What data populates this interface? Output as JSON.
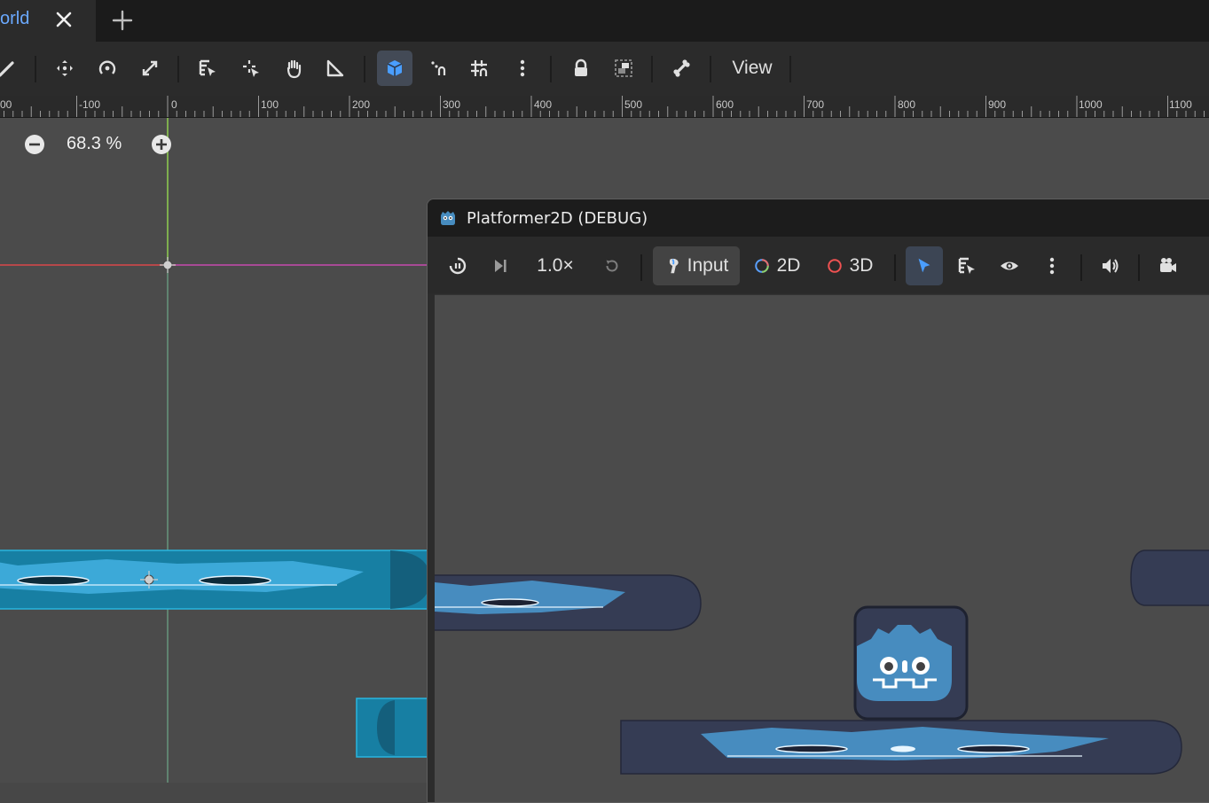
{
  "tabbar": {
    "active_tab_label": "orld",
    "close_icon": "close-icon",
    "add_icon": "plus-icon"
  },
  "toolbar": {
    "view_label": "View",
    "accent_color": "#4a9eff"
  },
  "ruler": {
    "labels": [
      "00",
      "-100",
      "0",
      "100",
      "200",
      "300",
      "400",
      "500",
      "600",
      "700",
      "800",
      "900",
      "1000",
      "1100"
    ]
  },
  "viewport": {
    "zoom_label": "68.3 %"
  },
  "game_window": {
    "title": "Platformer2D (DEBUG)",
    "speed_label": "1.0×",
    "input_label": "Input",
    "mode_2d_label": "2D",
    "mode_3d_label": "3D"
  },
  "colors": {
    "x_axis": "#d9484b",
    "y_axis": "#8fcf4f",
    "platform_selected": "#1b8fb8",
    "platform_dark": "#353c54",
    "godot_blue": "#478cbf"
  }
}
